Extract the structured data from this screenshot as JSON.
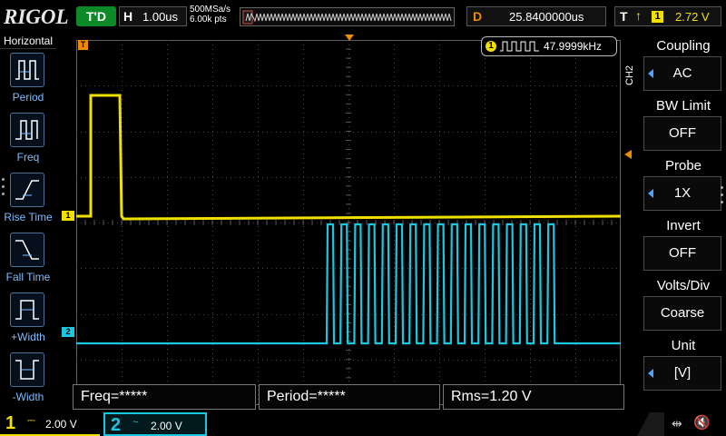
{
  "header": {
    "logo": "RIGOL",
    "run_status": "T'D",
    "horizontal": {
      "label": "H",
      "value": "1.00us"
    },
    "sample_rate": "500MSa/s",
    "memory_depth": "6.00k pts",
    "delay": {
      "label": "D",
      "value": "25.8400000us"
    },
    "trigger": {
      "label": "T",
      "edge_icon": "rising-edge-icon",
      "source": "1",
      "level": "2.72 V"
    }
  },
  "left_menu": {
    "title": "Horizontal",
    "items": [
      {
        "label": "Period",
        "icon": "period-icon"
      },
      {
        "label": "Freq",
        "icon": "freq-icon"
      },
      {
        "label": "Rise Time",
        "icon": "rise-time-icon"
      },
      {
        "label": "Fall Time",
        "icon": "fall-time-icon"
      },
      {
        "label": "+Width",
        "icon": "positive-width-icon"
      },
      {
        "label": "-Width",
        "icon": "negative-width-icon"
      }
    ]
  },
  "right_menu": {
    "channel_tag": "CH2",
    "items": [
      {
        "title": "Coupling",
        "value": "AC"
      },
      {
        "title": "BW Limit",
        "value": "OFF"
      },
      {
        "title": "Probe",
        "value": "1X"
      },
      {
        "title": "Invert",
        "value": "OFF"
      },
      {
        "title": "Volts/Div",
        "value": "Coarse"
      },
      {
        "title": "Unit",
        "value": "[V]"
      }
    ]
  },
  "screen": {
    "frequency_counter": {
      "channel": "1",
      "value": "47.9999kHz"
    },
    "markers": {
      "trigger_pos": "T",
      "ch1": "1",
      "ch2": "2"
    }
  },
  "measurements": [
    {
      "text": "Freq=*****"
    },
    {
      "text": "Period=*****"
    },
    {
      "text": "Rms=1.20 V"
    }
  ],
  "channels": [
    {
      "number": "1",
      "coupling_symbol": "⎓",
      "scale": "2.00 V",
      "color": "#f0e000"
    },
    {
      "number": "2",
      "coupling_symbol": "~",
      "scale": "2.00 V",
      "color": "#19c8e0"
    }
  ],
  "colors": {
    "ch1": "#f0e000",
    "ch2": "#19c8e0",
    "accent": "#f08a00",
    "menu_text": "#7bbcff"
  }
}
